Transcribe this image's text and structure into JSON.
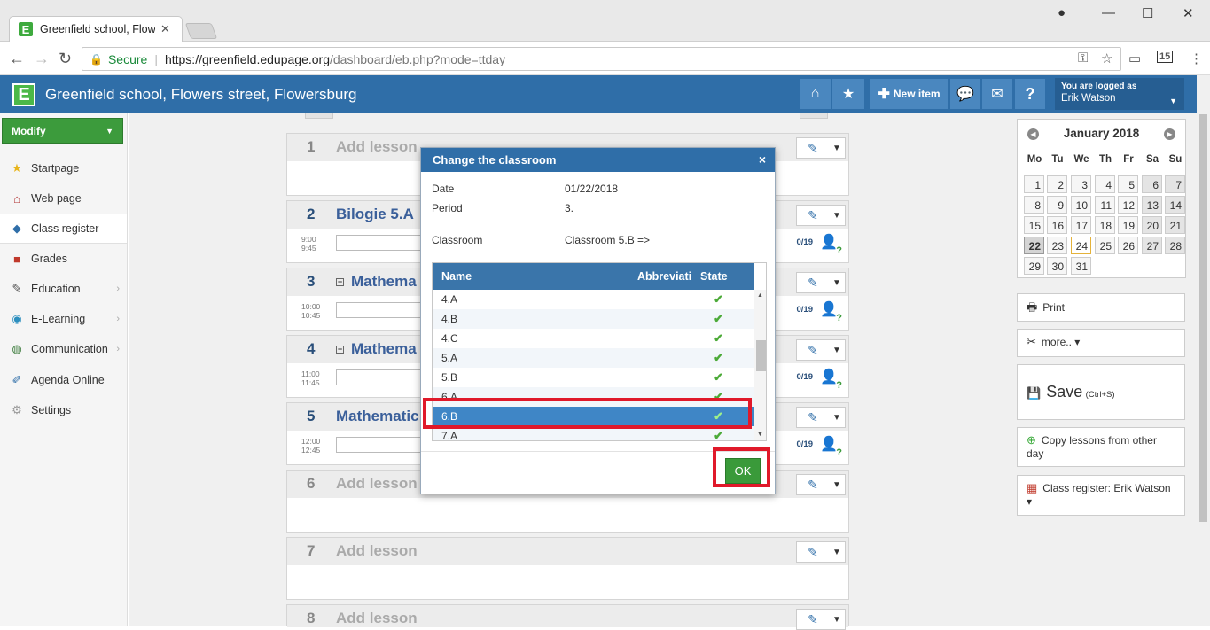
{
  "browser": {
    "tab_title": "Greenfield school, Flowe",
    "tab_favicon": "E",
    "secure_label": "Secure",
    "url_host": "https://greenfield.edupage.org",
    "url_path": "/dashboard/eb.php?mode=ttday",
    "ext_badge": "15"
  },
  "header": {
    "logo": "E",
    "school_name": "Greenfield school, Flowers street, Flowersburg",
    "new_item_label": "New item",
    "help_label": "?",
    "logged_label": "You are logged as",
    "user_name": "Erik Watson"
  },
  "sidebar": {
    "modify_label": "Modify",
    "items": [
      {
        "label": "Startpage",
        "icon": "star-icon"
      },
      {
        "label": "Web page",
        "icon": "house-icon"
      },
      {
        "label": "Class register",
        "icon": "book-icon"
      },
      {
        "label": "Grades",
        "icon": "grades-icon"
      },
      {
        "label": "Education",
        "icon": "education-icon"
      },
      {
        "label": "E-Learning",
        "icon": "globe-icon"
      },
      {
        "label": "Communication",
        "icon": "communication-icon"
      },
      {
        "label": "Agenda Online",
        "icon": "pen-icon"
      },
      {
        "label": "Settings",
        "icon": "gear-icon"
      }
    ]
  },
  "lessons": [
    {
      "num": "1",
      "title": "Add lesson",
      "filled": false
    },
    {
      "num": "2",
      "title": "Bilogie  5.A",
      "filled": true,
      "start": "9:00",
      "end": "9:45",
      "count": "0/19"
    },
    {
      "num": "3",
      "title": "Mathema",
      "filled": true,
      "start": "10:00",
      "end": "10:45",
      "count": "0/19"
    },
    {
      "num": "4",
      "title": "Mathema",
      "filled": true,
      "start": "11:00",
      "end": "11:45",
      "count": "0/19"
    },
    {
      "num": "5",
      "title": "Mathematic",
      "filled": true,
      "start": "12:00",
      "end": "12:45",
      "count": "0/19"
    },
    {
      "num": "6",
      "title": "Add lesson",
      "filled": false
    },
    {
      "num": "7",
      "title": "Add lesson",
      "filled": false
    },
    {
      "num": "8",
      "title": "Add lesson",
      "filled": false
    }
  ],
  "calendar": {
    "title": "January 2018",
    "weekdays": [
      "Mo",
      "Tu",
      "We",
      "Th",
      "Fr",
      "Sa",
      "Su"
    ],
    "weeks": [
      [
        "1",
        "2",
        "3",
        "4",
        "5",
        "6",
        "7"
      ],
      [
        "8",
        "9",
        "10",
        "11",
        "12",
        "13",
        "14"
      ],
      [
        "15",
        "16",
        "17",
        "18",
        "19",
        "20",
        "21"
      ],
      [
        "22",
        "23",
        "24",
        "25",
        "26",
        "27",
        "28"
      ],
      [
        "29",
        "30",
        "31",
        "",
        "",
        "",
        ""
      ]
    ],
    "selected_day": "22",
    "today_day": "24"
  },
  "right_buttons": {
    "print": "Print",
    "more": "more.. ▾",
    "save": "Save",
    "save_shortcut": "(Ctrl+S)",
    "copy": "Copy lessons from other day",
    "register": "Class register: Erik Watson ▾"
  },
  "modal": {
    "title": "Change the classroom",
    "close": "×",
    "date_label": "Date",
    "date_value": "01/22/2018",
    "period_label": "Period",
    "period_value": "3.",
    "classroom_label": "Classroom",
    "classroom_value": "Classroom 5.B =>",
    "columns": [
      "Name",
      "Abbreviati",
      "State"
    ],
    "rows": [
      "4.A",
      "4.B",
      "4.C",
      "5.A",
      "5.B",
      "6.A",
      "6.B",
      "7.A"
    ],
    "selected_row": "6.B",
    "ok_label": "OK"
  }
}
